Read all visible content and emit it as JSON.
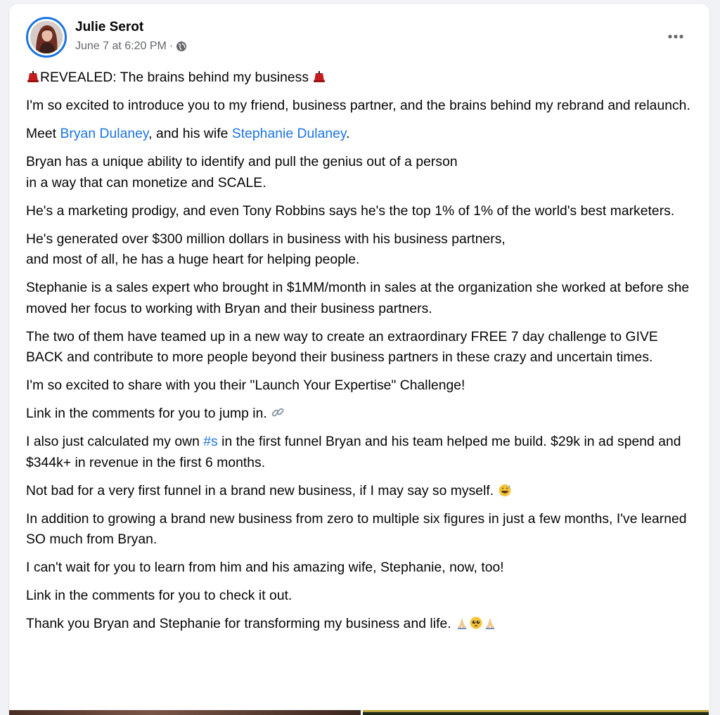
{
  "post": {
    "author": "Julie Serot",
    "timestamp": "June 7 at 6:20 PM",
    "separator": "·",
    "audience_icon": "globe-icon",
    "more_icon": "more-options-icon"
  },
  "content": {
    "p1_text": "REVEALED: The brains behind my business",
    "p1_emoji": "red-fez-hat-emoji",
    "p2": "I'm so excited to introduce you to my friend, business partner, and the brains behind my rebrand and relaunch.",
    "p3_before": "Meet ",
    "p3_link1": "Bryan Dulaney",
    "p3_middle": ", and his wife ",
    "p3_link2": "Stephanie Dulaney",
    "p3_after": ".",
    "p4_line1": "Bryan has a unique ability to identify and pull the genius out of a person",
    "p4_line2": "in a way that can monetize and SCALE.",
    "p5": "He's a marketing prodigy, and even Tony Robbins says he's the top 1% of 1% of the world's best marketers.",
    "p6_line1": "He's generated over $300 million dollars in business with his business partners,",
    "p6_line2": "and most of all, he has a huge heart for helping people.",
    "p7": "Stephanie is a sales expert who brought in $1MM/month in sales at the organization she worked at before she moved her focus to working with Bryan and their business partners.",
    "p8": "The two of them have teamed up in a new way to create an extraordinary FREE 7 day challenge to GIVE BACK and contribute to more people beyond their business partners in these crazy and uncertain times.",
    "p9": "I'm so excited to share with you their \"Launch Your Expertise\" Challenge!",
    "p10": "Link in the comments for you to jump in.",
    "p10_emoji": "link-emoji",
    "p11_before": "I also just calculated my own ",
    "p11_link": "#s",
    "p11_after": " in the first funnel Bryan and his team helped me build. $29k in ad spend and $344k+ in revenue in the first 6 months.",
    "p12": "Not bad for a very first funnel in a brand new business, if I may say so myself.",
    "p12_emoji": "grinning-sweat-emoji",
    "p13": "In addition to growing a brand new business from zero to multiple six figures in just a few months, I've learned SO much from Bryan.",
    "p14": "I can't wait for you to learn from him and his amazing wife, Stephanie, now, too!",
    "p15": "Link in the comments for you to check it out.",
    "p16": "Thank you Bryan and Stephanie for transforming my business and life.",
    "p16_emojis": [
      "folded-hands-emoji",
      "pleading-face-emoji",
      "folded-hands-emoji"
    ]
  },
  "colors": {
    "link": "#1b74e4",
    "text": "#050505",
    "secondary_text": "#65676b",
    "card": "#ffffff",
    "page_bg": "#f0f2f5"
  }
}
